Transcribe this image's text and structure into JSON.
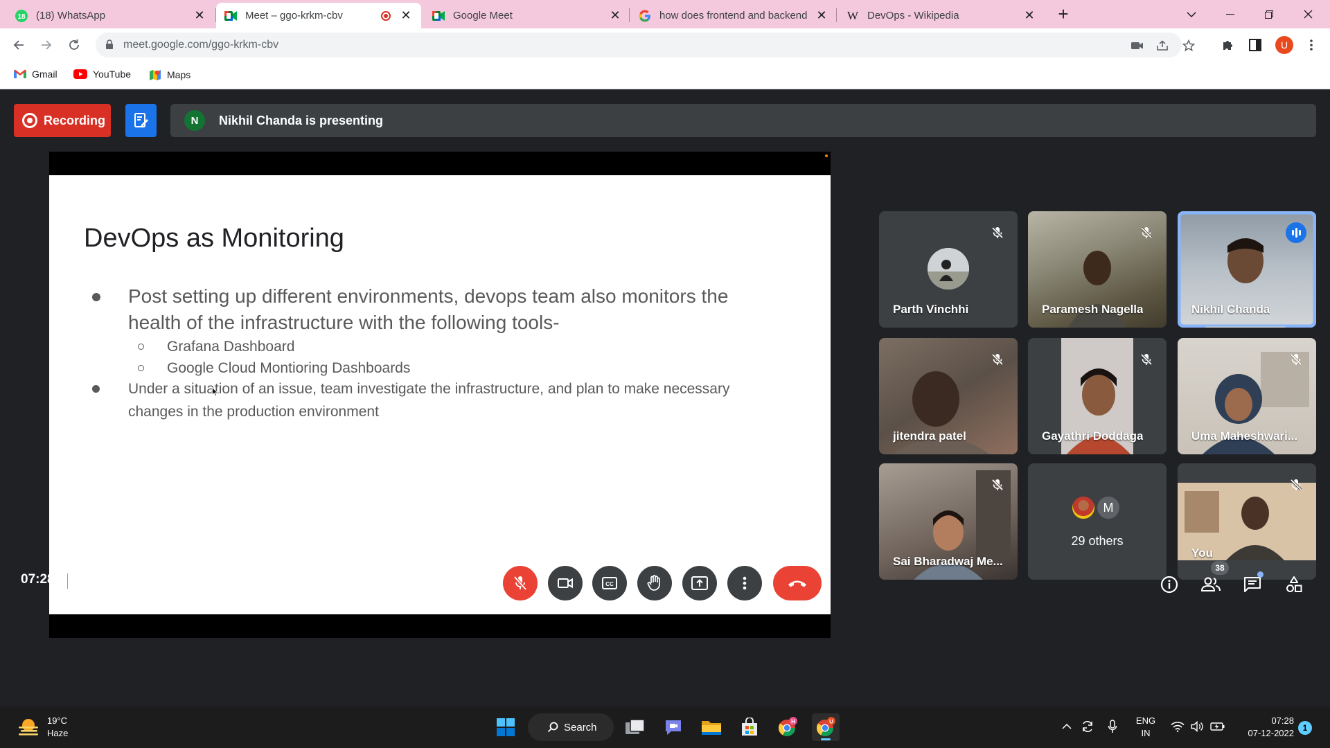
{
  "browser": {
    "tabs": [
      {
        "title": "(18) WhatsApp",
        "badge": "18"
      },
      {
        "title": "Meet – ggo-krkm-cbv"
      },
      {
        "title": "Google Meet"
      },
      {
        "title": "how does frontend and backend"
      },
      {
        "title": "DevOps - Wikipedia"
      }
    ],
    "url": "meet.google.com/ggo-krkm-cbv",
    "profile_initial": "U",
    "bookmarks": [
      {
        "label": "Gmail"
      },
      {
        "label": "YouTube"
      },
      {
        "label": "Maps"
      }
    ]
  },
  "meet": {
    "recording_label": "Recording",
    "presenter_initial": "N",
    "presenting_text": "Nikhil Chanda is presenting",
    "slide": {
      "title": "DevOps as Monitoring",
      "bullet1": "Post setting up different environments, devops team also monitors the health of the infrastructure with the following tools-",
      "sub_bullets": [
        "Grafana Dashboard",
        "Google Cloud Montioring Dashboards"
      ],
      "bullet2": "Under a situation of an issue, team investigate the infrastructure, and plan to make necessary changes in the production environment"
    },
    "participants": [
      {
        "name": "Parth Vinchhi",
        "muted": true
      },
      {
        "name": "Paramesh Nagella",
        "muted": true
      },
      {
        "name": "Nikhil Chanda",
        "muted": false,
        "speaking": true
      },
      {
        "name": "jitendra patel",
        "muted": true
      },
      {
        "name": "Gayathri Doddaga",
        "muted": true
      },
      {
        "name": "Uma Maheshwari...",
        "muted": true
      },
      {
        "name": "Sai Bharadwaj Me...",
        "muted": true
      },
      {
        "name": "29 others",
        "avatar_initial": "M"
      },
      {
        "name": "You",
        "muted": true
      }
    ],
    "time": "07:28",
    "meeting_code": "ggo-krkm-cbv",
    "participant_count": "38",
    "colors": {
      "accent": "#1a73e8",
      "danger": "#ea4335",
      "surface": "#3c4043",
      "background": "#202124"
    }
  },
  "taskbar": {
    "weather_temp": "19°C",
    "weather_desc": "Haze",
    "search_label": "Search",
    "chrome_badge": "H",
    "lang_line1": "ENG",
    "lang_line2": "IN",
    "time": "07:28",
    "date": "07-12-2022",
    "notifications": "1"
  }
}
